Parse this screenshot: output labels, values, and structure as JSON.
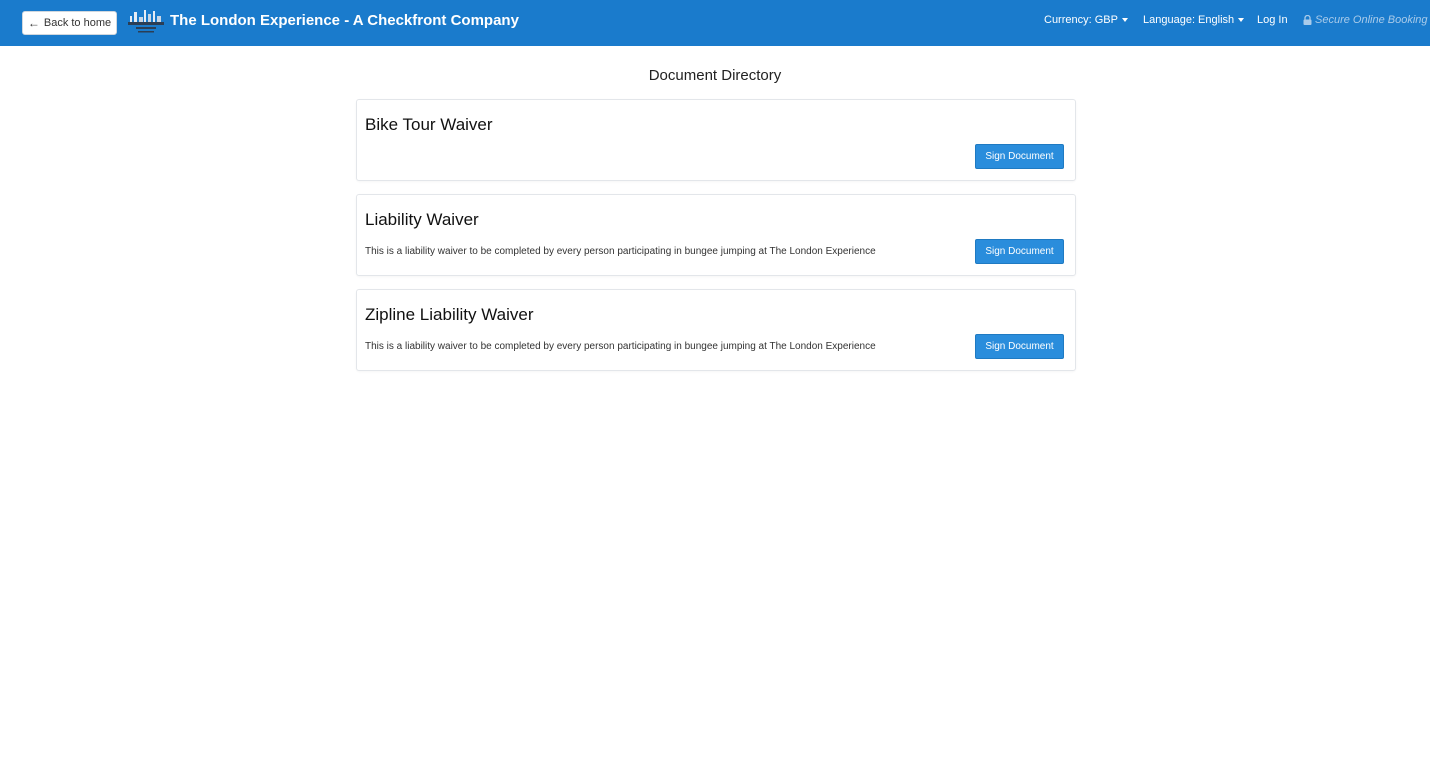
{
  "header": {
    "back_label": "Back to home",
    "brand": "The London Experience - A Checkfront Company",
    "currency_label": "Currency: GBP",
    "language_label": "Language: English",
    "login_label": "Log In",
    "secure_label": "Secure Online Booking",
    "colors": {
      "navbar": "#1a7bcc",
      "secure_text": "#a9cbea"
    }
  },
  "page": {
    "title": "Document Directory"
  },
  "documents": [
    {
      "title": "Bike Tour Waiver",
      "description": "",
      "button_label": "Sign Document"
    },
    {
      "title": "Liability Waiver",
      "description": "This is a liability waiver to be completed by every person participating in bungee jumping at The London Experience",
      "button_label": "Sign Document"
    },
    {
      "title": "Zipline Liability Waiver",
      "description": "This is a liability waiver to be completed by every person participating in bungee jumping at The London Experience",
      "button_label": "Sign Document"
    }
  ],
  "colors": {
    "button": "#2a8ddc"
  }
}
